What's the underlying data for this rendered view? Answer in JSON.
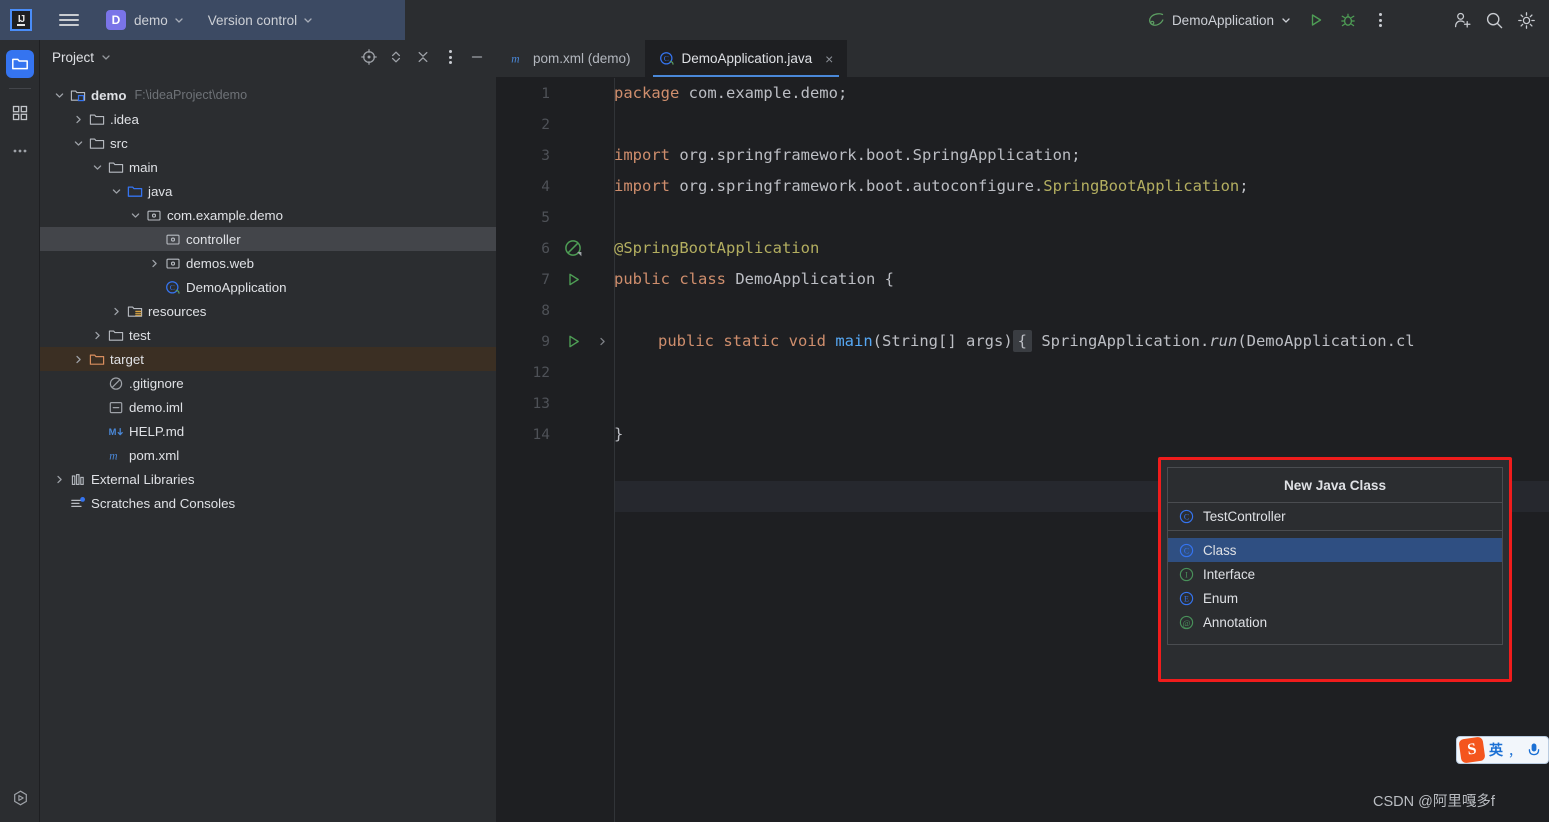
{
  "titlebar": {
    "logo_icon": "intellij-idea-logo",
    "menu_icon": "hamburger-menu-icon",
    "project_badge": "D",
    "project_name": "demo",
    "version_control": "Version control",
    "run_config": "DemoApplication",
    "run_icon": "run-play-icon",
    "debug_icon": "debug-bug-icon",
    "more_icon": "more-vertical-icon",
    "add_user_icon": "add-user-icon",
    "search_icon": "search-icon",
    "settings_icon": "gear-icon"
  },
  "activity_bar": {
    "items": [
      {
        "name": "project-icon",
        "active": true
      },
      {
        "name": "structure-icon",
        "active": false
      },
      {
        "name": "more-tools-icon",
        "active": false
      }
    ],
    "bottom_icon": "run-hexagon-icon"
  },
  "project_panel": {
    "title": "Project",
    "chevron_icon": "chevron-down-icon",
    "actions": [
      {
        "name": "select-opened-file-icon"
      },
      {
        "name": "expand-collapse-icon"
      },
      {
        "name": "collapse-all-icon"
      },
      {
        "name": "options-menu-icon"
      },
      {
        "name": "hide-panel-icon"
      }
    ],
    "tree": [
      {
        "label": "demo",
        "path": "F:\\ideaProject\\demo",
        "indent": 0,
        "twist": "down",
        "icon": "module-folder-icon",
        "bold": true,
        "state": "none"
      },
      {
        "label": ".idea",
        "path": "",
        "indent": 1,
        "twist": "right",
        "icon": "folder-icon",
        "bold": false,
        "state": "none"
      },
      {
        "label": "src",
        "path": "",
        "indent": 1,
        "twist": "down",
        "icon": "folder-icon",
        "bold": false,
        "state": "none"
      },
      {
        "label": "main",
        "path": "",
        "indent": 2,
        "twist": "down",
        "icon": "folder-icon",
        "bold": false,
        "state": "none"
      },
      {
        "label": "java",
        "path": "",
        "indent": 3,
        "twist": "down",
        "icon": "source-root-folder-icon",
        "bold": false,
        "state": "none"
      },
      {
        "label": "com.example.demo",
        "path": "",
        "indent": 4,
        "twist": "down",
        "icon": "package-icon",
        "bold": false,
        "state": "none"
      },
      {
        "label": "controller",
        "path": "",
        "indent": 5,
        "twist": "none",
        "icon": "package-icon",
        "bold": false,
        "state": "selected"
      },
      {
        "label": "demos.web",
        "path": "",
        "indent": 5,
        "twist": "right",
        "icon": "package-icon",
        "bold": false,
        "state": "none"
      },
      {
        "label": "DemoApplication",
        "path": "",
        "indent": 5,
        "twist": "none",
        "icon": "spring-class-icon",
        "bold": false,
        "state": "none"
      },
      {
        "label": "resources",
        "path": "",
        "indent": 3,
        "twist": "right",
        "icon": "resources-folder-icon",
        "bold": false,
        "state": "none"
      },
      {
        "label": "test",
        "path": "",
        "indent": 2,
        "twist": "right",
        "icon": "folder-icon",
        "bold": false,
        "state": "none"
      },
      {
        "label": "target",
        "path": "",
        "indent": 1,
        "twist": "right",
        "icon": "excluded-folder-icon",
        "bold": false,
        "state": "highlighted"
      },
      {
        "label": ".gitignore",
        "path": "",
        "indent": 2,
        "twist": "none",
        "icon": "gitignore-icon",
        "bold": false,
        "state": "none"
      },
      {
        "label": "demo.iml",
        "path": "",
        "indent": 2,
        "twist": "none",
        "icon": "iml-file-icon",
        "bold": false,
        "state": "none"
      },
      {
        "label": "HELP.md",
        "path": "",
        "indent": 2,
        "twist": "none",
        "icon": "markdown-icon",
        "bold": false,
        "state": "none"
      },
      {
        "label": "pom.xml",
        "path": "",
        "indent": 2,
        "twist": "none",
        "icon": "maven-icon",
        "bold": false,
        "state": "none"
      },
      {
        "label": "External Libraries",
        "path": "",
        "indent": 0,
        "twist": "right",
        "icon": "libraries-icon",
        "bold": false,
        "state": "none"
      },
      {
        "label": "Scratches and Consoles",
        "path": "",
        "indent": 0,
        "twist": "none",
        "icon": "scratches-icon",
        "bold": false,
        "state": "none"
      }
    ]
  },
  "editor": {
    "tabs": [
      {
        "label": "pom.xml (demo)",
        "icon": "maven-icon",
        "active": false,
        "closable": false
      },
      {
        "label": "DemoApplication.java",
        "icon": "spring-class-icon",
        "active": true,
        "closable": true
      }
    ],
    "close_glyph": "×",
    "lines": [
      {
        "num": "1",
        "marker": "none",
        "fold": "none"
      },
      {
        "num": "2",
        "marker": "none",
        "fold": "none"
      },
      {
        "num": "3",
        "marker": "none",
        "fold": "none"
      },
      {
        "num": "4",
        "marker": "none",
        "fold": "none"
      },
      {
        "num": "5",
        "marker": "none",
        "fold": "none"
      },
      {
        "num": "6",
        "marker": "spring-bean-icon",
        "fold": "none"
      },
      {
        "num": "7",
        "marker": "run-gutter-icon",
        "fold": "none"
      },
      {
        "num": "8",
        "marker": "none",
        "fold": "none"
      },
      {
        "num": "9",
        "marker": "run-gutter-icon",
        "fold": "collapsed"
      },
      {
        "num": "12",
        "marker": "none",
        "fold": "none"
      },
      {
        "num": "13",
        "marker": "none",
        "fold": "none"
      },
      {
        "num": "14",
        "marker": "none",
        "fold": "none"
      }
    ],
    "code": {
      "l1_kw": "package",
      "l1_rest": " com.example.demo;",
      "l3_kw": "import",
      "l3_rest": " org.springframework.boot.SpringApplication;",
      "l4_kw": "import",
      "l4_a": " org.springframework.boot.autoconfigure.",
      "l4_b": "SpringBootApplication",
      "l4_c": ";",
      "l6_ann": "@SpringBootApplication",
      "l7_kw1": "public",
      "l7_kw2": " class",
      "l7_rest": " DemoApplication {",
      "l9_kw1": "public",
      "l9_kw2": " static",
      "l9_kw3": " void",
      "l9_mth": " main",
      "l9_params": "(String[] args)",
      "l9_fold": "{",
      "l9_tail1": " SpringApplication.",
      "l9_run": "run",
      "l9_tail2": "(DemoApplication.cl",
      "l13_brace": "}"
    }
  },
  "popup": {
    "title": "New Java Class",
    "existing": {
      "label": "TestController",
      "icon": "java-class-icon",
      "glyph": "C"
    },
    "items": [
      {
        "label": "Class",
        "icon": "java-class-icon",
        "glyph": "C",
        "color": "#3574f0",
        "selected": true
      },
      {
        "label": "Interface",
        "icon": "java-interface-icon",
        "glyph": "I",
        "color": "#49915a",
        "selected": false
      },
      {
        "label": "Enum",
        "icon": "java-enum-icon",
        "glyph": "E",
        "color": "#3574f0",
        "selected": false
      },
      {
        "label": "Annotation",
        "icon": "java-annotation-icon",
        "glyph": "@",
        "color": "#49915a",
        "selected": false
      }
    ],
    "highlight_color": "#f01c1c"
  },
  "ime": {
    "logo": "S",
    "mode": "英",
    "punct": "，",
    "mic_icon": "microphone-icon"
  },
  "watermark": {
    "text": "CSDN @阿里嘎多f"
  }
}
